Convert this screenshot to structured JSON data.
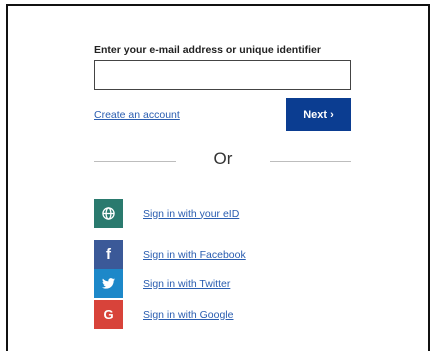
{
  "login": {
    "email_label": "Enter your e-mail address or unique identifier",
    "email_value": "",
    "email_placeholder": "",
    "create_account": "Create an account",
    "next_button": "Next ›",
    "or_text": "Or"
  },
  "social": [
    {
      "label": "Sign in with your eID",
      "icon": "globe-icon",
      "color": "#2a7a6e",
      "glyph": "⊕"
    },
    {
      "label": "Sign in with Facebook",
      "icon": "facebook-icon",
      "color": "#3b5998",
      "glyph": "f"
    },
    {
      "label": "Sign in with Twitter",
      "icon": "twitter-icon",
      "color": "#1d88c9",
      "glyph": "✈"
    },
    {
      "label": "Sign in with Google",
      "icon": "google-icon",
      "color": "#d8433a",
      "glyph": "G"
    }
  ]
}
